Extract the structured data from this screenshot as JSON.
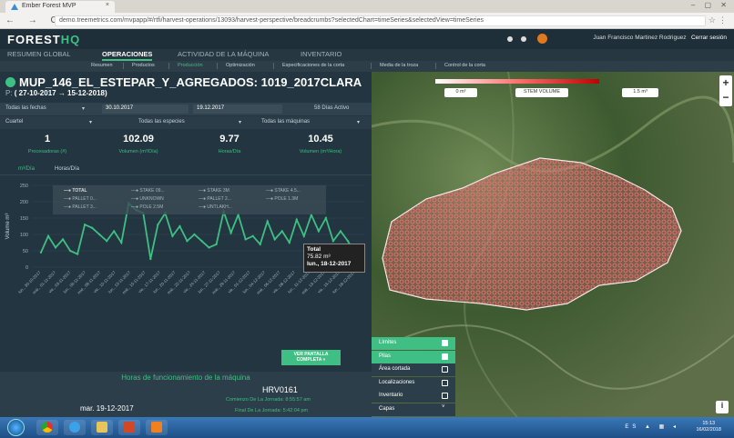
{
  "browser": {
    "tab_title": "Ember Forest MVP",
    "url": "demo.treemetrics.com/mvpapp/#/rtfi/harvest-operations/13093/harvest-perspective/breadcrumbs?selectedChart=timeSeries&selectedView=timeSeries"
  },
  "header": {
    "logo_a": "FOREST",
    "logo_b": "HQ",
    "user": "Juan Francisco Martinez Rodriguez",
    "logout": "Cerrar sesión"
  },
  "mainnav": [
    "RESUMEN GLOBAL",
    "OPERACIONES",
    "ACTIVIDAD DE LA MÁQUINA",
    "INVENTARIO"
  ],
  "subnav": [
    "Resumen",
    "Productos",
    "Producción",
    "Optimización",
    "Especificaciones de la corta",
    "Media de la troza",
    "Control de la corta"
  ],
  "panel": {
    "title": "MUP_146_EL_ESTEPAR_Y_AGREGADOS: 1019_2017CLARA",
    "period_label": "P:",
    "period": "( 27-10-2017 → 15-12-2018)",
    "filters": {
      "all_dates": "Todas las fechas",
      "from": "30.10.2017",
      "to": "19.12.2017",
      "active": "58 Días Activo",
      "cuartel": "Cuartel",
      "species": "Todas las especies",
      "machines": "Todas las máquinas"
    },
    "kpis": [
      {
        "value": "1",
        "label": "Procesadoras (#)"
      },
      {
        "value": "102.09",
        "label": "Volumen (m³/Día)"
      },
      {
        "value": "9.77",
        "label": "Horas/Día"
      },
      {
        "value": "10.45",
        "label": "Volumen (m³/Hora)"
      }
    ],
    "chart_tabs": [
      "m³/Día",
      "Horas/Día"
    ],
    "legend": [
      "TOTAL",
      "PALLET 0...",
      "PALLET 3...",
      "STAKE 09...",
      "UNKNOWN",
      "POLE 2.5M",
      "STAKE 3M",
      "PALLET 2...",
      "UNTLAKH...",
      "STAKE 4.5...",
      "POLE 1.3M"
    ],
    "tooltip": {
      "title": "Total",
      "value": "75.82 m³",
      "date": "lun., 18-12-2017"
    },
    "full_screen": "VER PANTALLA COMPLETA »",
    "bottom": {
      "title": "Horas de funcionamiento de la máquina",
      "machine": "HRV0161",
      "start": "Comienzo De La Jornada: 8:55:57 am",
      "end": "Final De La Jornada: 5:42:04 pm",
      "date": "mar. 19-12-2017"
    }
  },
  "chart_data": {
    "type": "line",
    "ylabel": "Volume m³",
    "ylim": [
      0,
      250
    ],
    "yticks": [
      0,
      50,
      100,
      150,
      200,
      250
    ],
    "x": [
      "lun., 30-10-2017",
      "mié., 01-11-2017",
      "vie., 03-11-2017",
      "lun., 06-11-2017",
      "mié., 08-11-2017",
      "vie., 10-11-2017",
      "lun., 13-11-2017",
      "mié., 15-11-2017",
      "vie., 17-11-2017",
      "lun., 20-11-2017",
      "mié., 22-11-2017",
      "vie., 24-11-2017",
      "lun., 27-11-2017",
      "mié., 29-11-2017",
      "vie., 01-12-2017",
      "lun., 04-12-2017",
      "mié., 06-12-2017",
      "vie., 08-12-2017",
      "lun., 11-12-2017",
      "mié., 13-12-2017",
      "vie., 15-12-2017",
      "lun., 18-12-2017"
    ],
    "series": [
      {
        "name": "TOTAL",
        "values": [
          45,
          95,
          60,
          85,
          50,
          40,
          130,
          120,
          100,
          80,
          110,
          75,
          195,
          175,
          165,
          25,
          130,
          165,
          95,
          125,
          80,
          100,
          80,
          60,
          70,
          170,
          105,
          160,
          85,
          95,
          70,
          140,
          85,
          110,
          75,
          145,
          95,
          160,
          110,
          150,
          80,
          110,
          80,
          40
        ]
      }
    ],
    "grid": true
  },
  "map": {
    "scale_min": "0 m³",
    "scale_label": "STEM VOLUME",
    "scale_max": "1.5 m³",
    "layers": [
      {
        "label": "Límites",
        "on": true
      },
      {
        "label": "Pilas",
        "on": true
      },
      {
        "label": "Área cortada",
        "on": false
      },
      {
        "label": "Localizaciones",
        "on": false
      },
      {
        "label": "Inventario",
        "on": false
      },
      {
        "label": "Capas",
        "on": false
      }
    ]
  },
  "taskbar": {
    "time": "15:13",
    "date": "16/02/2018",
    "lang": "ES"
  }
}
